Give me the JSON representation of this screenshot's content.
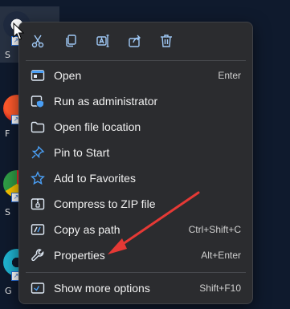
{
  "desktop": {
    "labels": [
      "S",
      "F",
      "S",
      "G"
    ]
  },
  "toolbar": {
    "cut": "cut-icon",
    "copy": "copy-icon",
    "rename": "rename-icon",
    "share": "share-icon",
    "delete": "delete-icon"
  },
  "menu": {
    "items": [
      {
        "label": "Open",
        "accel": "Enter",
        "icon": "open-window-icon"
      },
      {
        "label": "Run as administrator",
        "accel": "",
        "icon": "shield-icon"
      },
      {
        "label": "Open file location",
        "accel": "",
        "icon": "folder-icon"
      },
      {
        "label": "Pin to Start",
        "accel": "",
        "icon": "pin-icon"
      },
      {
        "label": "Add to Favorites",
        "accel": "",
        "icon": "star-icon"
      },
      {
        "label": "Compress to ZIP file",
        "accel": "",
        "icon": "zip-icon"
      },
      {
        "label": "Copy as path",
        "accel": "Ctrl+Shift+C",
        "icon": "copy-path-icon"
      },
      {
        "label": "Properties",
        "accel": "Alt+Enter",
        "icon": "wrench-icon"
      },
      {
        "label": "Show more options",
        "accel": "Shift+F10",
        "icon": "more-options-icon"
      }
    ]
  },
  "colors": {
    "accent": "#4a9ff5",
    "annotation": "#e53935",
    "menu_bg": "#2b2c2f"
  }
}
